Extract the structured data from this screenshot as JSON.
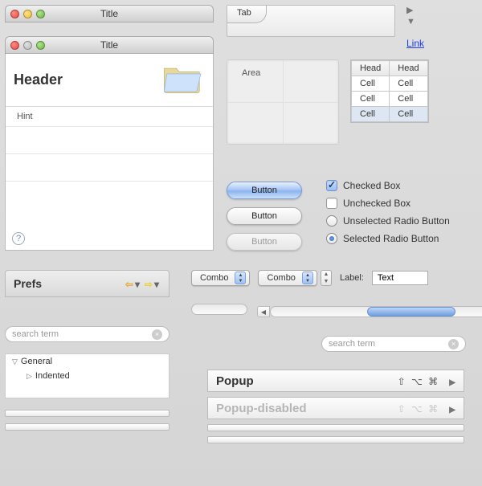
{
  "window1": {
    "title": "Title"
  },
  "window2": {
    "title": "Title",
    "header": "Header",
    "hint": "Hint"
  },
  "tab": {
    "label": "Tab"
  },
  "link": {
    "text": "Link"
  },
  "area": {
    "label": "Area"
  },
  "table": {
    "headers": [
      "Head",
      "Head"
    ],
    "rows": [
      [
        "Cell",
        "Cell"
      ],
      [
        "Cell",
        "Cell"
      ],
      [
        "Cell",
        "Cell"
      ]
    ]
  },
  "buttons": {
    "default": "Button",
    "white": "Button",
    "disabled": "Button"
  },
  "options": {
    "checked": "Checked Box",
    "unchecked": "Unchecked Box",
    "radio_off": "Unselected Radio Button",
    "radio_on": "Selected Radio Button"
  },
  "prefs": {
    "title": "Prefs",
    "search": "search term",
    "tree": {
      "root": "General",
      "child": "Indented"
    }
  },
  "combos": {
    "c1": "Combo",
    "c2": "Combo",
    "label": "Label:",
    "text": "Text"
  },
  "search2": "search term",
  "popups": {
    "enabled": "Popup",
    "disabled": "Popup-disabled",
    "shortcut": "⇧ ⌥ ⌘"
  }
}
